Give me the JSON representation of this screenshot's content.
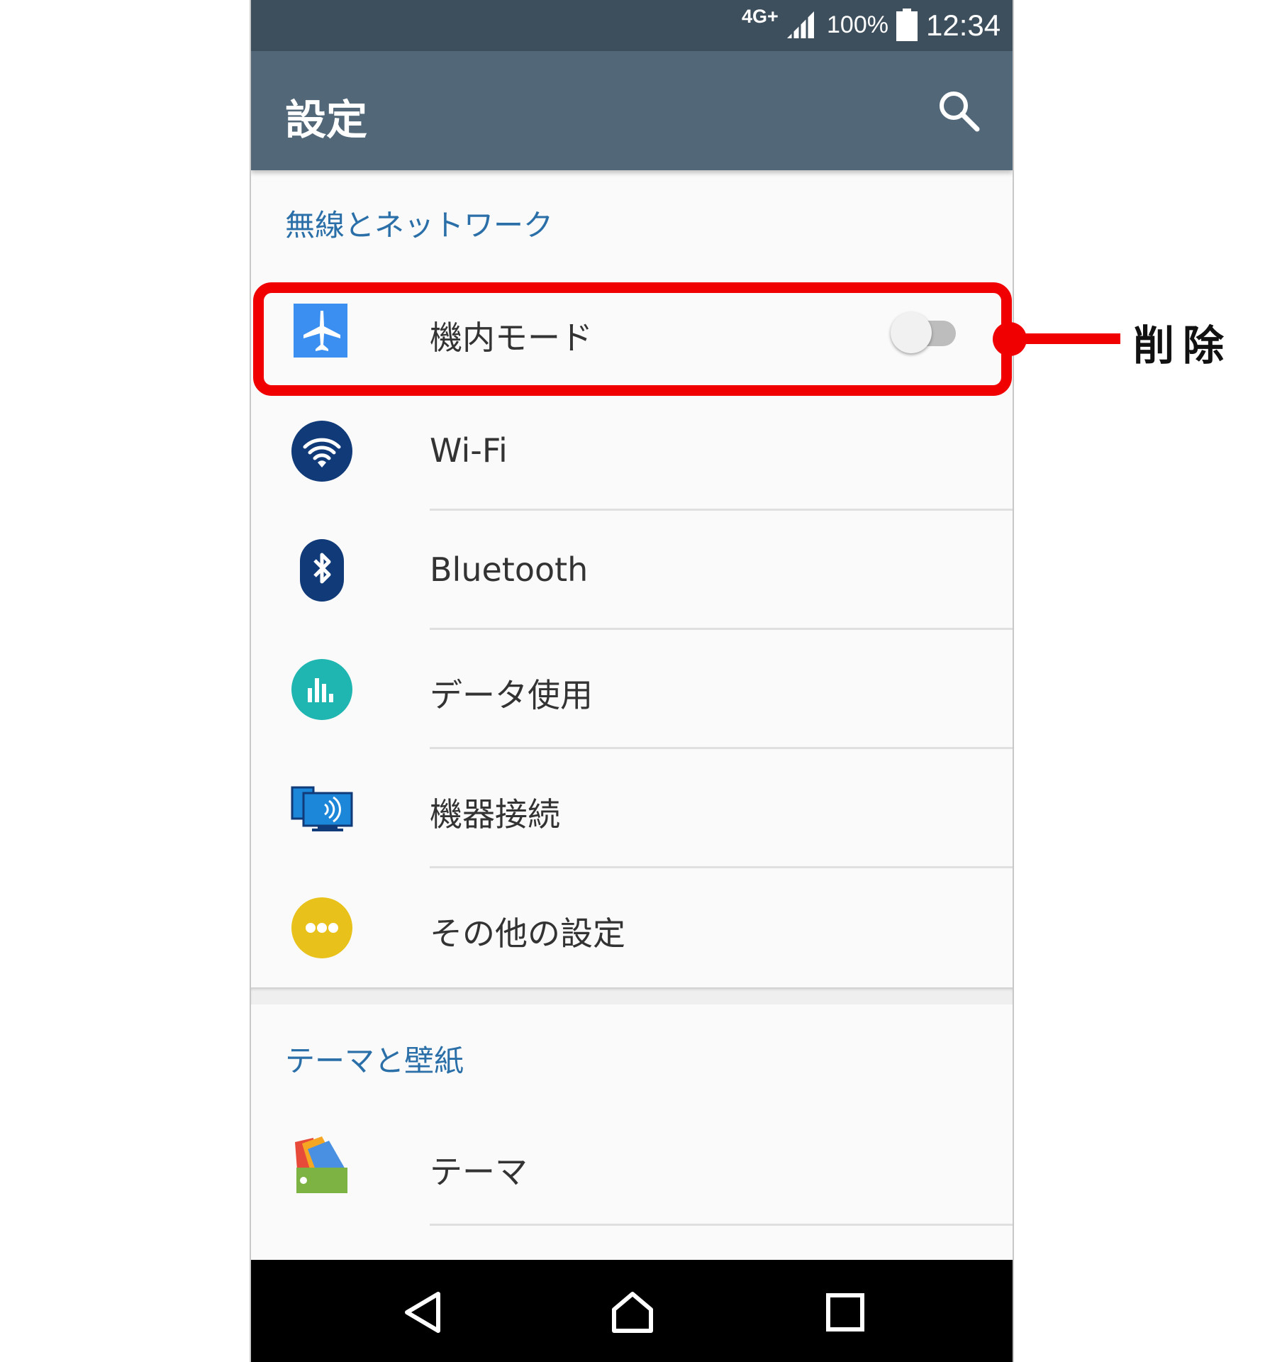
{
  "status_bar": {
    "network": "4G+",
    "battery_percent": "100%",
    "time": "12:34"
  },
  "app_bar": {
    "title": "設定",
    "search_icon": "search-icon"
  },
  "sections": [
    {
      "header": "無線とネットワーク",
      "items": [
        {
          "label": "機内モード",
          "icon": "airplane-icon",
          "toggle_on": false
        },
        {
          "label": "Wi-Fi",
          "icon": "wifi-icon"
        },
        {
          "label": "Bluetooth",
          "icon": "bluetooth-icon"
        },
        {
          "label": "データ使用",
          "icon": "data-usage-icon"
        },
        {
          "label": "機器接続",
          "icon": "device-connection-icon"
        },
        {
          "label": "その他の設定",
          "icon": "more-icon"
        }
      ]
    },
    {
      "header": "テーマと壁紙",
      "items": [
        {
          "label": "テーマ",
          "icon": "theme-icon"
        }
      ]
    }
  ],
  "nav_bar": {
    "icons": [
      "back-icon",
      "home-icon",
      "recents-icon"
    ]
  },
  "annotation": {
    "label": "削除",
    "color": "#f00000"
  },
  "colors": {
    "status_bar": "#3d4f5c",
    "app_bar": "#526879",
    "section_header": "#2b6fa8",
    "airplane": "#3b8ff0",
    "wifi": "#113a78",
    "bluetooth": "#113a78",
    "data_usage": "#1fb5b0",
    "device_connection": "#1c86d8",
    "more": "#e8c21a"
  }
}
